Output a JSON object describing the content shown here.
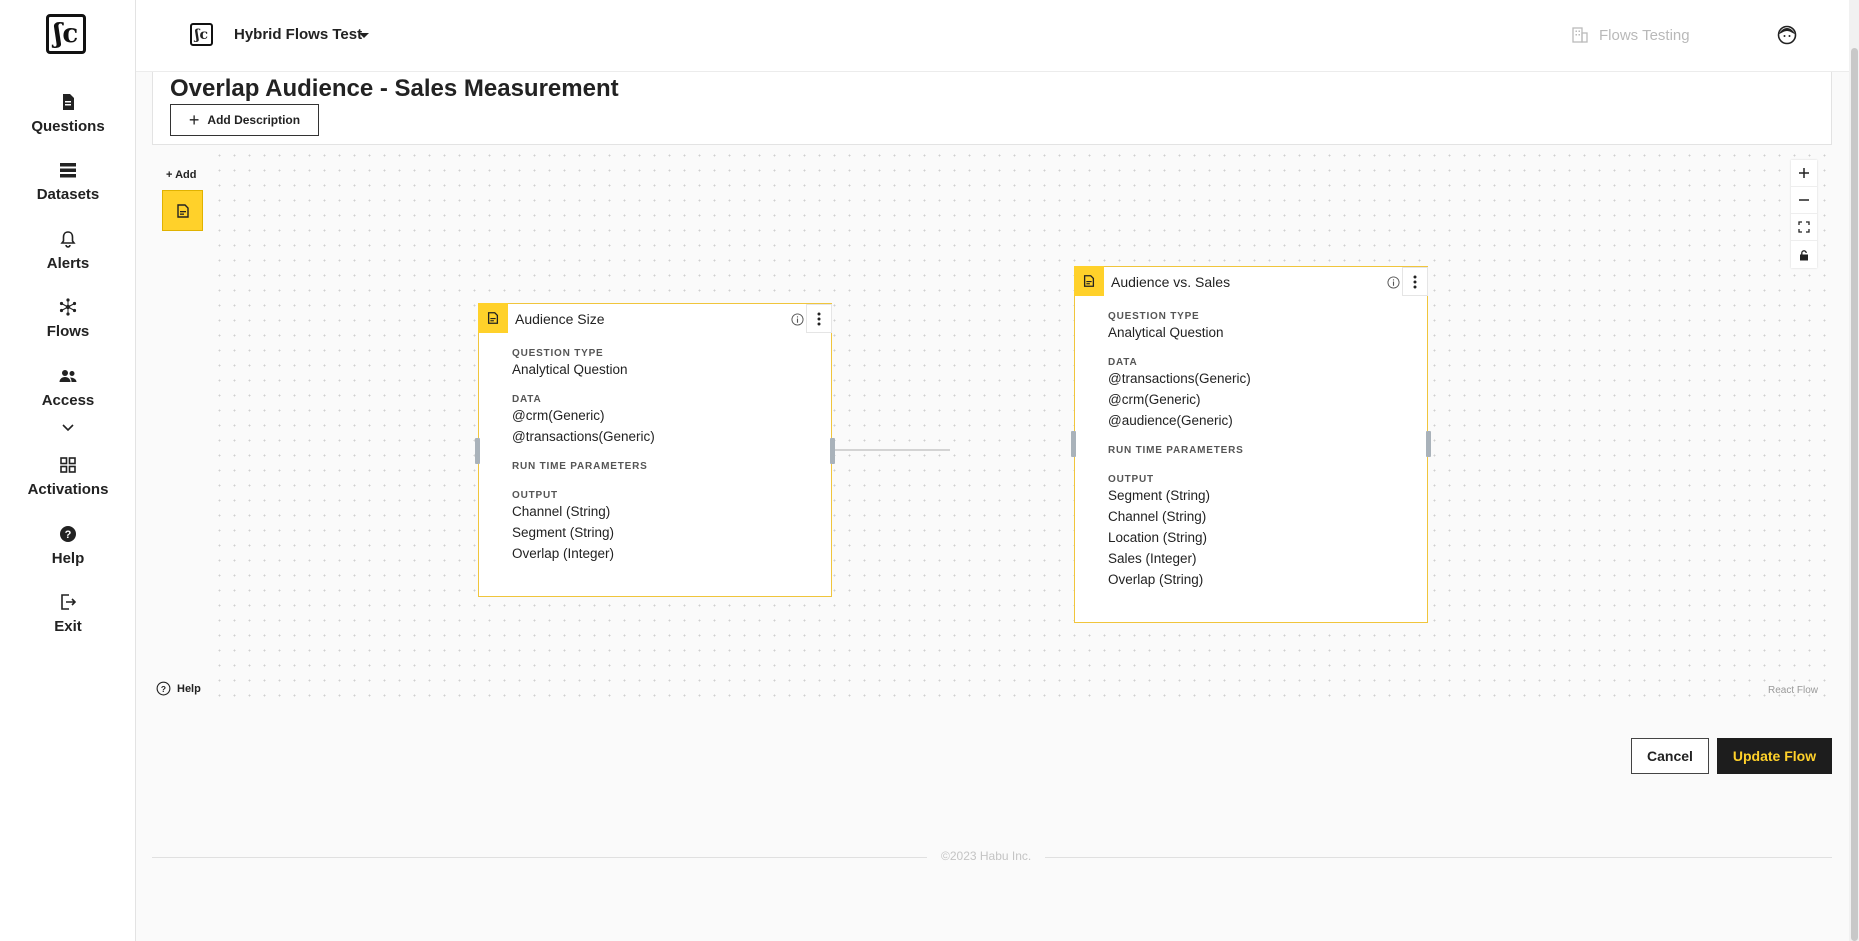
{
  "sidebar": {
    "logo_text": "ʃc",
    "items": [
      {
        "label": "Questions",
        "icon": "document-icon"
      },
      {
        "label": "Datasets",
        "icon": "list-icon"
      },
      {
        "label": "Alerts",
        "icon": "bell-icon"
      },
      {
        "label": "Flows",
        "icon": "network-icon"
      },
      {
        "label": "Access",
        "icon": "people-icon"
      },
      {
        "label": "Activations",
        "icon": "grid-icon"
      },
      {
        "label": "Help",
        "icon": "help-circle-icon"
      },
      {
        "label": "Exit",
        "icon": "exit-icon"
      }
    ]
  },
  "topbar": {
    "logo_text": "ʃc",
    "workspace": "Hybrid Flows Test",
    "org": "Flows Testing"
  },
  "header": {
    "title": "Overlap Audience - Sales Measurement",
    "add_description": "Add Description"
  },
  "canvas": {
    "palette_add": "+ Add",
    "help": "Help",
    "attribution": "React Flow",
    "nodes": [
      {
        "title": "Audience Size",
        "question_type_label": "QUESTION TYPE",
        "question_type": "Analytical Question",
        "data_label": "DATA",
        "data": [
          "@crm(Generic)",
          "@transactions(Generic)"
        ],
        "runtime_label": "RUN TIME PARAMETERS",
        "output_label": "OUTPUT",
        "output": [
          "Channel (String)",
          "Segment (String)",
          "Overlap (Integer)"
        ]
      },
      {
        "title": "Audience vs. Sales",
        "question_type_label": "QUESTION TYPE",
        "question_type": "Analytical Question",
        "data_label": "DATA",
        "data": [
          "@transactions(Generic)",
          "@crm(Generic)",
          "@audience(Generic)"
        ],
        "runtime_label": "RUN TIME PARAMETERS",
        "output_label": "OUTPUT",
        "output": [
          "Segment (String)",
          "Channel (String)",
          "Location (String)",
          "Sales (Integer)",
          "Overlap (String)"
        ]
      }
    ]
  },
  "actions": {
    "cancel": "Cancel",
    "update": "Update Flow"
  },
  "footer": {
    "copyright": "©2023 Habu Inc."
  },
  "colors": {
    "accent": "#ffd12a",
    "dark": "#1d1d1d"
  }
}
